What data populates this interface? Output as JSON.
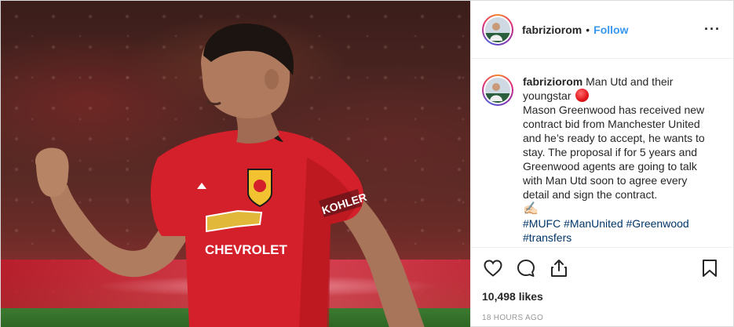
{
  "post": {
    "username": "fabriziorom",
    "separator": "•",
    "follow_label": "Follow",
    "more_label": "···",
    "caption": {
      "text_line1": "Man Utd and their youngstar",
      "body": "Mason Greenwood has received new contract bid from Manchester United and he’s ready to accept, he wants to stay. The proposal if for 5 years and Greenwood agents are going to talk with Man Utd soon to agree every detail and sign the contract.",
      "emoji_end": "✍🏻",
      "hashtags": [
        "#MUFC",
        "#ManUnited",
        "#Greenwood",
        "#transfers"
      ]
    },
    "likes": "10,498 likes",
    "timestamp": "18 HOURS AGO",
    "photo_text": {
      "sponsor": "CHEVROLET",
      "sleeve": "KOHLER"
    },
    "icons": {
      "like": "heart-icon",
      "comment": "comment-icon",
      "share": "share-icon",
      "save": "bookmark-icon",
      "more": "more-options-icon"
    },
    "colors": {
      "follow": "#3897f0",
      "hashtag": "#003569",
      "shirt": "#d4202a",
      "timestamp": "#999999"
    }
  }
}
